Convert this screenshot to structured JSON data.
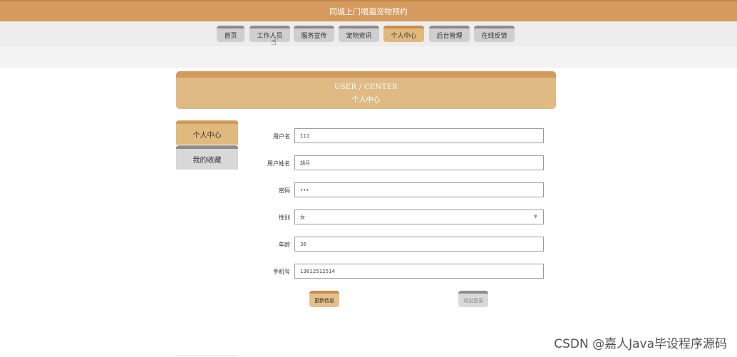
{
  "app": {
    "title": "同城上门喂遛宠物预约"
  },
  "nav": {
    "items": [
      {
        "label": "首页"
      },
      {
        "label": "工作人员"
      },
      {
        "label": "服务宣传"
      },
      {
        "label": "宠物资讯"
      },
      {
        "label": "个人中心"
      },
      {
        "label": "后台管理"
      },
      {
        "label": "在线反馈"
      }
    ],
    "active": "个人中心"
  },
  "banner": {
    "en": "USER / CENTER",
    "cn": "个人中心"
  },
  "side_menu": {
    "items": [
      {
        "label": "个人中心"
      },
      {
        "label": "我的收藏"
      }
    ]
  },
  "form": {
    "username": {
      "label": "用户名",
      "value": "111"
    },
    "realname": {
      "label": "用户姓名",
      "value": "胡月"
    },
    "password": {
      "label": "密码",
      "value": "•••"
    },
    "gender": {
      "label": "性别",
      "value": "女"
    },
    "age": {
      "label": "年龄",
      "value": "36"
    },
    "phone": {
      "label": "手机号",
      "value": "13612512514"
    }
  },
  "buttons": {
    "update": "更新信息",
    "logout": "退出登录"
  },
  "watermark": "CSDN @嘉人Java毕设程序源码",
  "colors": {
    "accent": "#d59a5d",
    "active_tab": "#e0b97f",
    "inactive_tab": "#cfcfcf"
  },
  "icons": {
    "cursor": "hand-pointer-icon",
    "select": "chevron-down-icon"
  }
}
